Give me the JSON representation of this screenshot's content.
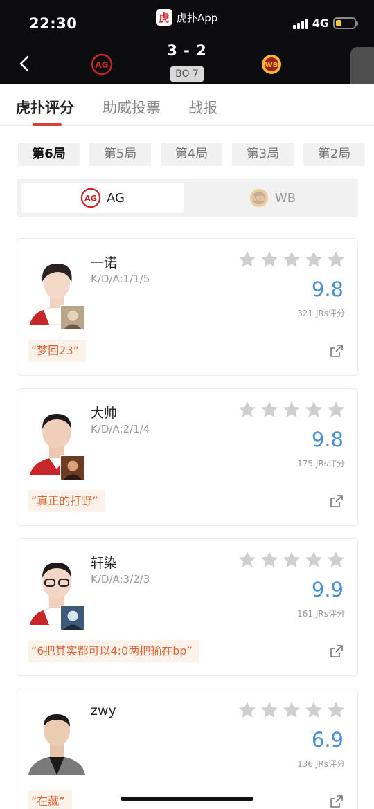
{
  "status_bar": {
    "time": "22:30",
    "network": "4G",
    "battery_level": 0.3
  },
  "app": {
    "logo_char": "虎",
    "name": "虎扑App"
  },
  "match": {
    "score": "3 - 2",
    "format": "BO 7",
    "team_a": "AG",
    "team_b": "WB"
  },
  "tabs": [
    {
      "label": "虎扑评分",
      "active": true
    },
    {
      "label": "助威投票",
      "active": false
    },
    {
      "label": "战报",
      "active": false
    }
  ],
  "games": [
    "第6局",
    "第5局",
    "第4局",
    "第3局",
    "第2局"
  ],
  "selected_game": "第6局",
  "teams": [
    {
      "label": "AG",
      "active": true
    },
    {
      "label": "WB",
      "active": false
    }
  ],
  "players": [
    {
      "name": "一诺",
      "kda": "K/D/A:1/1/5",
      "rating": "9.8",
      "count": "321 JRs评分",
      "quote": "“梦回23”"
    },
    {
      "name": "大帅",
      "kda": "K/D/A:2/1/4",
      "rating": "9.8",
      "count": "175 JRs评分",
      "quote": "“真正的打野”"
    },
    {
      "name": "轩染",
      "kda": "K/D/A:3/2/3",
      "rating": "9.9",
      "count": "161 JRs评分",
      "quote": "“6把其实都可以4:0两把输在bp”"
    },
    {
      "name": "zwy",
      "kda": "",
      "rating": "6.9",
      "count": "136 JRs评分",
      "quote": "“在藏”"
    }
  ],
  "colors": {
    "accent_red": "#d8413a",
    "rating_blue": "#4a8fd8",
    "quote_orange": "#dd6437",
    "star_gray": "#cfcfcf"
  },
  "icons": [
    "back-chevron-icon",
    "ag-team-logo-icon",
    "wb-team-logo-icon",
    "star-icon",
    "share-icon"
  ]
}
